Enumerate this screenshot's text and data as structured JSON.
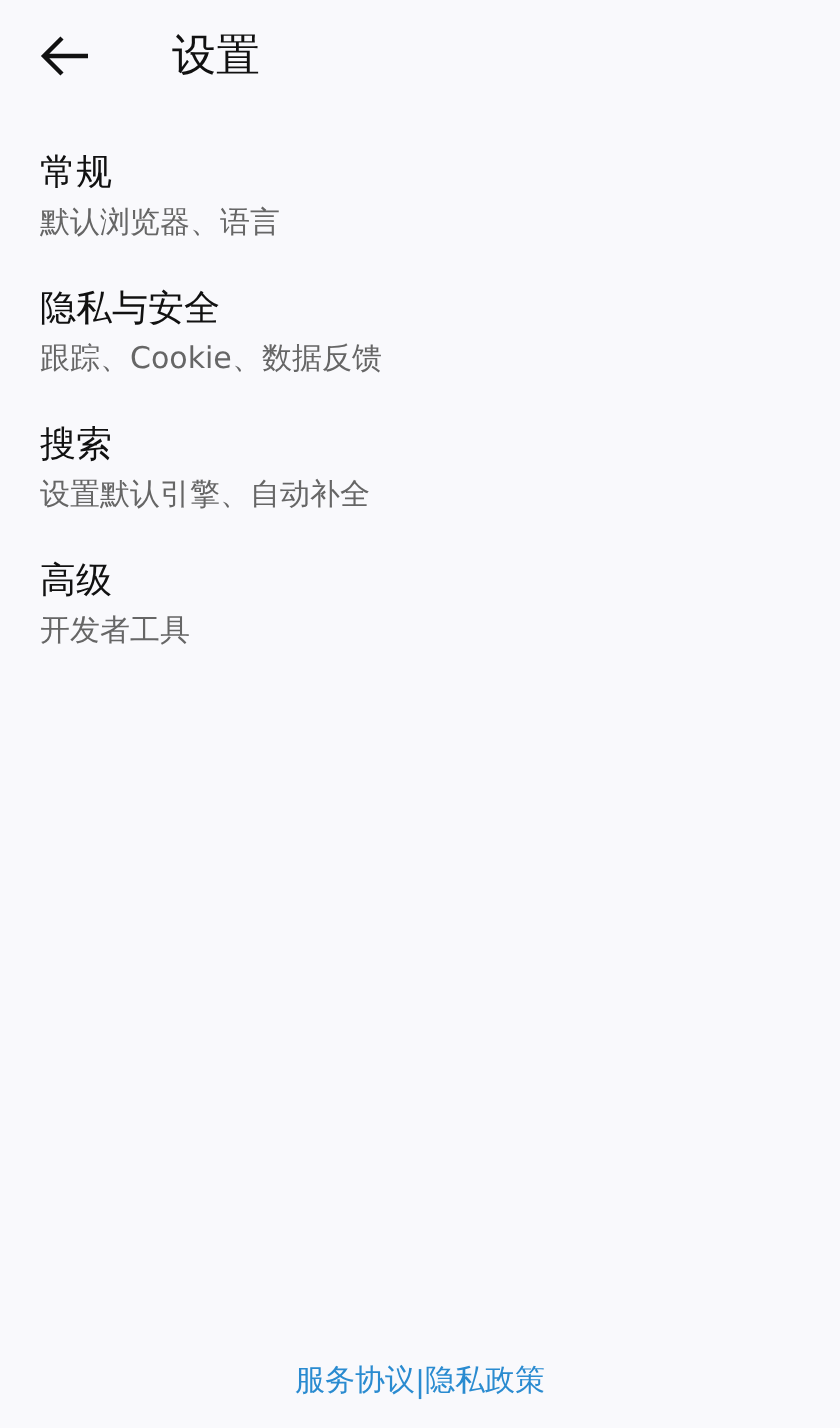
{
  "header": {
    "title": "设置"
  },
  "items": [
    {
      "title": "常规",
      "subtitle": "默认浏览器、语言"
    },
    {
      "title": "隐私与安全",
      "subtitle": "跟踪、Cookie、数据反馈"
    },
    {
      "title": "搜索",
      "subtitle": "设置默认引擎、自动补全"
    },
    {
      "title": "高级",
      "subtitle": "开发者工具"
    }
  ],
  "footer": {
    "links": [
      "服务协议",
      "隐私政策"
    ],
    "separator": "|"
  }
}
